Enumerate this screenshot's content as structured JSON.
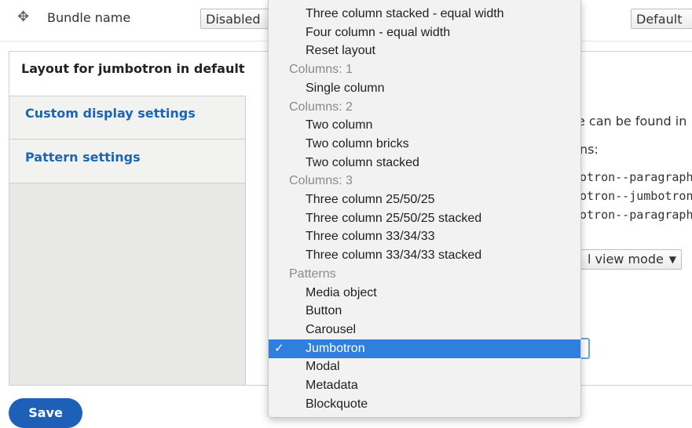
{
  "bundle_row": {
    "label": "Bundle name",
    "region_value": "Disabled",
    "format_value": "Default"
  },
  "vertical_tabs": {
    "active": "Layout for jumbotron in default",
    "custom": "Custom display settings",
    "pattern": "Pattern settings"
  },
  "pane": {
    "line1": "e can be found in",
    "line2": "ns:",
    "line3": "otron--paragraph",
    "line4": "otron--jumbotron",
    "line5": "otron--paragraph",
    "view_mode": "l view mode"
  },
  "save_label": "Save",
  "dropdown": {
    "items": [
      {
        "text": "Three column stacked - equal width",
        "kind": "option"
      },
      {
        "text": "Four column - equal width",
        "kind": "option"
      },
      {
        "text": "Reset layout",
        "kind": "option"
      },
      {
        "text": "Columns: 1",
        "kind": "group"
      },
      {
        "text": "Single column",
        "kind": "option"
      },
      {
        "text": "Columns: 2",
        "kind": "group"
      },
      {
        "text": "Two column",
        "kind": "option"
      },
      {
        "text": "Two column bricks",
        "kind": "option"
      },
      {
        "text": "Two column stacked",
        "kind": "option"
      },
      {
        "text": "Columns: 3",
        "kind": "group"
      },
      {
        "text": "Three column 25/50/25",
        "kind": "option"
      },
      {
        "text": "Three column 25/50/25 stacked",
        "kind": "option"
      },
      {
        "text": "Three column 33/34/33",
        "kind": "option"
      },
      {
        "text": "Three column 33/34/33 stacked",
        "kind": "option"
      },
      {
        "text": "Patterns",
        "kind": "group"
      },
      {
        "text": "Media object",
        "kind": "option"
      },
      {
        "text": "Button",
        "kind": "option"
      },
      {
        "text": "Carousel",
        "kind": "option"
      },
      {
        "text": "Jumbotron",
        "kind": "selected"
      },
      {
        "text": "Modal",
        "kind": "option"
      },
      {
        "text": "Metadata",
        "kind": "option"
      },
      {
        "text": "Blockquote",
        "kind": "option"
      }
    ]
  },
  "icons": {
    "drag": "drag-handle-icon",
    "check": "checkmark-icon",
    "caret": "caret-down-icon"
  },
  "colors": {
    "link": "#1a66b5",
    "selected": "#2f7fe0",
    "button": "#1e5fb8"
  }
}
